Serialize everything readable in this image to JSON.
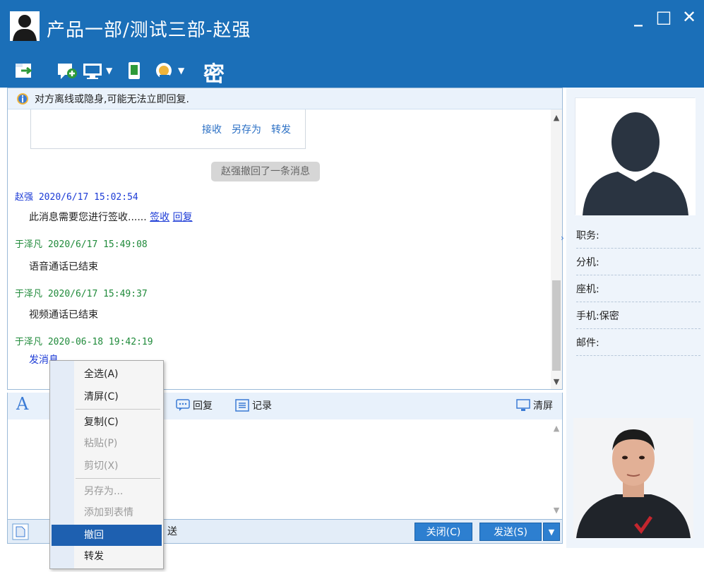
{
  "window": {
    "title": "产品一部/测试三部-赵强",
    "controls": [
      "_",
      "□",
      "✕"
    ]
  },
  "toolbar": {
    "secret_label": "密"
  },
  "notice": {
    "text": "对方离线或隐身,可能无法立即回复."
  },
  "file_actions": [
    "接收",
    "另存为",
    "转发"
  ],
  "recall_notice": "赵强撤回了一条消息",
  "messages": [
    {
      "sender": "赵强",
      "time": "2020/6/17 15:02:54",
      "body": "此消息需要您进行签收......",
      "links": [
        "签收",
        "回复"
      ]
    },
    {
      "sender": "于泽凡",
      "time": "2020/6/17 15:49:08",
      "body": "语音通话已结束"
    },
    {
      "sender": "于泽凡",
      "time": "2020/6/17 15:49:37",
      "body": "视频通话已结束"
    },
    {
      "sender": "于泽凡",
      "time": "2020-06-18 19:42:19",
      "body": "发消息"
    }
  ],
  "format_bar": {
    "font_label": "A",
    "reply_label": "回复",
    "record_label": "记录",
    "clear_label": "清屏"
  },
  "bottom": {
    "send_mode_text": "送",
    "close_label": "关闭(C)",
    "send_label": "发送(S)",
    "dropdown_label": "▼"
  },
  "contact_info": {
    "fields": [
      {
        "label": "职务:",
        "value": ""
      },
      {
        "label": "分机:",
        "value": ""
      },
      {
        "label": "座机:",
        "value": ""
      },
      {
        "label": "手机:",
        "value": "保密"
      },
      {
        "label": "邮件:",
        "value": ""
      }
    ]
  },
  "context_menu": {
    "items": [
      {
        "label": "全选(A)",
        "disabled": false
      },
      {
        "label": "清屏(C)",
        "disabled": false
      },
      {
        "label": "复制(C)",
        "disabled": false
      },
      {
        "label": "粘贴(P)",
        "disabled": true
      },
      {
        "label": "剪切(X)",
        "disabled": true
      },
      {
        "label": "另存为...",
        "disabled": true
      },
      {
        "label": "添加到表情",
        "disabled": true
      },
      {
        "label": "撤回",
        "disabled": false,
        "selected": true
      },
      {
        "label": "转发",
        "disabled": false
      }
    ]
  },
  "colors": {
    "title_bar": "#1b6fb8",
    "sender_self": "#1c3bd6",
    "sender_other": "#1f8a3a",
    "menu_selected": "#1e60b0"
  }
}
